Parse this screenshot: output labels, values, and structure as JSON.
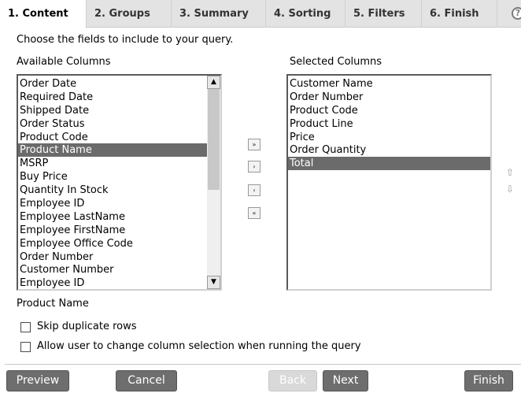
{
  "tabs": [
    {
      "label": "1. Content",
      "active": true
    },
    {
      "label": "2. Groups"
    },
    {
      "label": "3. Summary"
    },
    {
      "label": "4. Sorting"
    },
    {
      "label": "5. Filters"
    },
    {
      "label": "6. Finish"
    }
  ],
  "instructions": "Choose the fields to include to your query.",
  "available": {
    "label": "Available Columns",
    "items": [
      "Order Date",
      "Required Date",
      "Shipped Date",
      "Order Status",
      "Product Code",
      "Product Name",
      "MSRP",
      "Buy Price",
      "Quantity In Stock",
      "Employee ID",
      "Employee LastName",
      "Employee FirstName",
      "Employee Office Code",
      "Order Number",
      "Customer Number",
      "Employee ID"
    ],
    "selected": "Product Name"
  },
  "selected_columns": {
    "label": "Selected Columns",
    "items": [
      "Customer Name",
      "Order Number",
      "Product Code",
      "Product Line",
      "Price",
      "Order Quantity",
      "Total"
    ],
    "selected": "Total"
  },
  "move_buttons": {
    "add_all": "»",
    "add": "›",
    "remove": "‹",
    "remove_all": "«"
  },
  "field_description": "Product Name",
  "options": {
    "skip_duplicates": {
      "label": "Skip duplicate rows",
      "checked": false
    },
    "allow_change": {
      "label": "Allow user to change column selection when running the query",
      "checked": false
    }
  },
  "buttons": {
    "preview": "Preview",
    "cancel": "Cancel",
    "back": "Back",
    "next": "Next",
    "finish": "Finish"
  },
  "icons": {
    "help": "?",
    "move_up": "⇧",
    "move_down": "⇩"
  }
}
